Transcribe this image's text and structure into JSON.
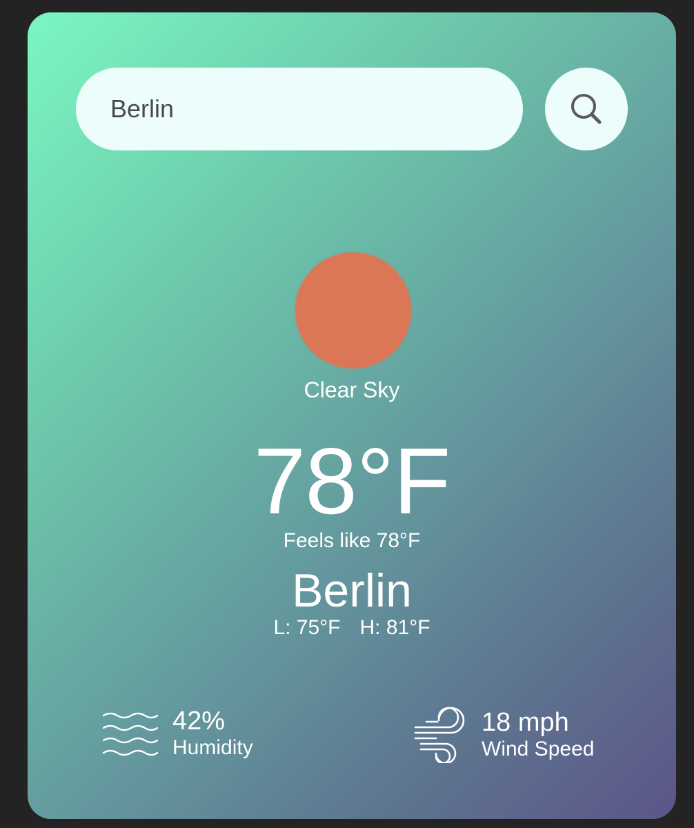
{
  "search": {
    "value": "Berlin",
    "button_icon": "search-icon"
  },
  "weather": {
    "icon": "clear-sky-sun-icon",
    "icon_color": "#db7656",
    "condition": "Clear Sky",
    "temperature": "78°F",
    "feels_like": "Feels like 78°F",
    "city": "Berlin",
    "low": "L: 75°F",
    "high": "H: 81°F"
  },
  "stats": {
    "humidity": {
      "value": "42%",
      "label": "Humidity",
      "icon": "humidity-waves-icon"
    },
    "wind": {
      "value": "18 mph",
      "label": "Wind Speed",
      "icon": "wind-icon"
    }
  },
  "colors": {
    "background": "#232323",
    "gradient_start": "#7af7c1",
    "gradient_end": "#5c5589",
    "search_field": "#ecfdfb",
    "text": "#ffffff"
  }
}
